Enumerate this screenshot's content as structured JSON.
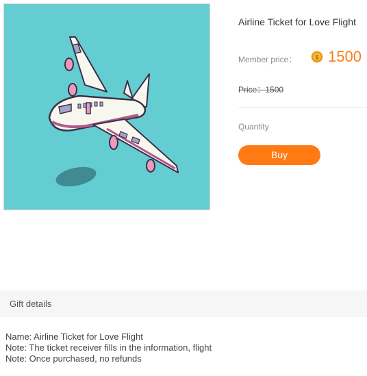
{
  "product": {
    "title": "Airline Ticket for Love Flight",
    "member_price_label": "Member price：",
    "member_price_value": "1500",
    "original_price": "Price：1500",
    "quantity_label": "Quantity",
    "buy_label": "Buy",
    "coin_icon": "coin-icon",
    "image_icon": "airplane-illustration"
  },
  "gift_details": {
    "header": "Gift details",
    "lines": [
      "Name: Airline Ticket for Love Flight",
      "Note: The ticket receiver fills in the information, flight",
      "Note: Once purchased, no refunds"
    ]
  },
  "colors": {
    "accent": "#ff7a13",
    "image_bg": "#64cdd1"
  }
}
